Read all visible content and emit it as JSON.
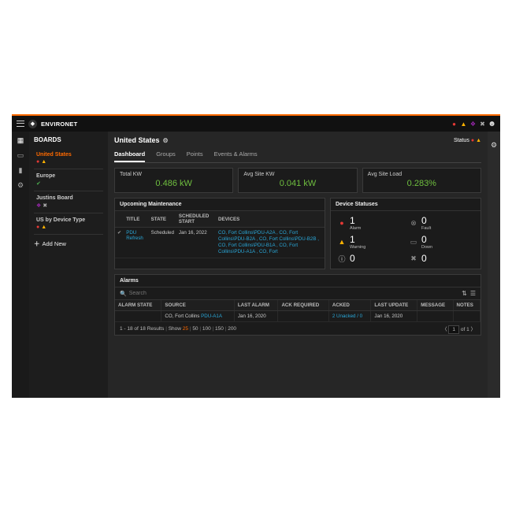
{
  "header": {
    "brand": "ENVIRONET"
  },
  "sidebar": {
    "title": "BOARDS",
    "items": [
      {
        "name": "United States"
      },
      {
        "name": "Europe"
      },
      {
        "name": "Justins Board"
      },
      {
        "name": "US by Device Type"
      }
    ],
    "add": "Add New"
  },
  "page": {
    "title": "United States",
    "status_label": "Status"
  },
  "tabs": {
    "t0": "Dashboard",
    "t1": "Groups",
    "t2": "Points",
    "t3": "Events & Alarms"
  },
  "kpis": {
    "k0": {
      "label": "Total KW",
      "value": "0.486 kW"
    },
    "k1": {
      "label": "Avg Site KW",
      "value": "0.041 kW"
    },
    "k2": {
      "label": "Avg Site Load",
      "value": "0.283%"
    }
  },
  "maint": {
    "title": "Upcoming Maintenance",
    "cols": {
      "c1": "TITLE",
      "c2": "STATE",
      "c3": "SCHEDULED START",
      "c4": "DEVICES"
    },
    "row": {
      "title": "PDU Refresh",
      "state": "Scheduled",
      "date": "Jan 16, 2022",
      "devices": "CO, Fort Collins\\PDU-A2A , CO, Fort Collins\\PDU-B2A , CO, Fort Collins\\PDU-B2B , CO, Fort Collins\\PDU-B1A , CO, Fort Collins\\PDU-A1A , CO, Fort"
    }
  },
  "statuses": {
    "title": "Device Statuses",
    "alarm": {
      "label": "Alarm",
      "count": "1"
    },
    "fault": {
      "label": "Fault",
      "count": "0"
    },
    "warning": {
      "label": "Warning",
      "count": "1"
    },
    "down": {
      "label": "Down",
      "count": "0"
    },
    "info": {
      "label": "",
      "count": "0"
    },
    "maint": {
      "label": "",
      "count": "0"
    }
  },
  "alarms": {
    "title": "Alarms",
    "search_placeholder": "Search",
    "cols": {
      "c1": "ALARM STATE",
      "c2": "SOURCE",
      "c3": "LAST ALARM",
      "c4": "ACK REQUIRED",
      "c5": "ACKED",
      "c6": "LAST UPDATE",
      "c7": "MESSAGE",
      "c8": "NOTES"
    },
    "row": {
      "source_prefix": "CO, Fort Collins ",
      "source_link": "PDU-A1A",
      "last_alarm": "Jan 16, 2020",
      "acked": "2 Unacked / 0",
      "last_update": "Jan 16, 2020"
    },
    "pager": {
      "results": "1 - 18 of 18 Results",
      "show": "Show",
      "p25": "25",
      "p50": "50",
      "p100": "100",
      "p150": "150",
      "p200": "200",
      "page": "1",
      "of": "of 1"
    }
  }
}
